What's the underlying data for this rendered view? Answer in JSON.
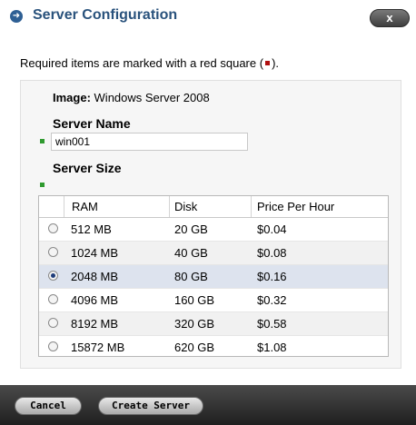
{
  "dialog": {
    "title": "Server Configuration",
    "close_label": "x"
  },
  "hint": {
    "text_before": "Required items are marked with a red square (",
    "text_after": ")."
  },
  "form": {
    "image_label": "Image:",
    "image_value": "Windows Server 2008",
    "server_name_label": "Server Name",
    "server_name_value": "win001",
    "server_size_label": "Server Size"
  },
  "table": {
    "columns": [
      "RAM",
      "Disk",
      "Price Per Hour"
    ],
    "rows": [
      {
        "ram": "512 MB",
        "disk": "20 GB",
        "price": "$0.04",
        "selected": false
      },
      {
        "ram": "1024 MB",
        "disk": "40 GB",
        "price": "$0.08",
        "selected": false
      },
      {
        "ram": "2048 MB",
        "disk": "80 GB",
        "price": "$0.16",
        "selected": true
      },
      {
        "ram": "4096 MB",
        "disk": "160 GB",
        "price": "$0.32",
        "selected": false
      },
      {
        "ram": "8192 MB",
        "disk": "320 GB",
        "price": "$0.58",
        "selected": false
      },
      {
        "ram": "15872 MB",
        "disk": "620 GB",
        "price": "$1.08",
        "selected": false
      }
    ]
  },
  "footer": {
    "cancel_label": "Cancel",
    "create_label": "Create Server"
  },
  "colors": {
    "title": "#29527c",
    "required_mark": "#b01010",
    "field_marker": "#2f9a2f",
    "selected_row": "#dde3ee"
  }
}
